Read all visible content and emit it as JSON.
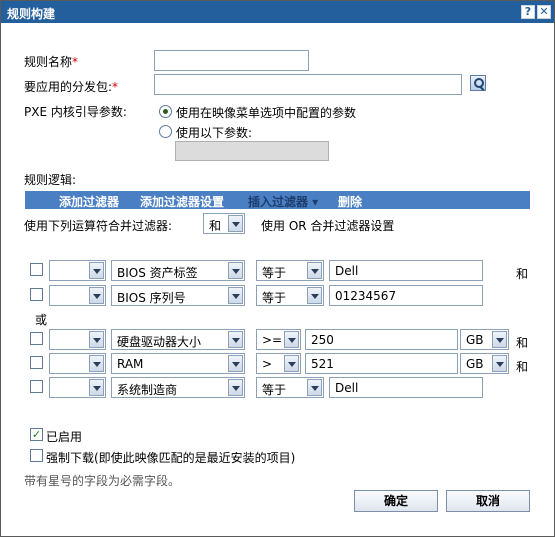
{
  "dialog": {
    "title": "规则构建",
    "help_label": "?",
    "close_label": "✕"
  },
  "form": {
    "rule_name_label": "规则名称",
    "rule_name_value": "",
    "bundle_label": "要应用的分发包:",
    "bundle_value": "",
    "required_mark": "*",
    "pxe_label": "PXE 内核引导参数:",
    "pxe_option_menu": "使用在映像菜单选项中配置的参数",
    "pxe_option_custom": "使用以下参数:",
    "pxe_custom_value": ""
  },
  "logic": {
    "section_label": "规则逻辑:",
    "toolbar": {
      "add_filter": "添加过滤器",
      "add_filter_set": "添加过滤器设置",
      "insert_filter": "插入过滤器 ▾",
      "delete": "删除"
    },
    "combine_label": "使用下列运算符合并过滤器:",
    "combine_operator": "和",
    "combine_sets_label": "使用 OR 合并过滤器设置",
    "or_label": "或",
    "filters": [
      {
        "checked": false,
        "prefix": "",
        "field": "BIOS 资产标签",
        "op": "等于",
        "value": "Dell",
        "unit": "",
        "connector": "和"
      },
      {
        "checked": false,
        "prefix": "",
        "field": "BIOS 序列号",
        "op": "等于",
        "value": "01234567",
        "unit": "",
        "connector": ""
      },
      {
        "checked": false,
        "prefix": "",
        "field": "硬盘驱动器大小",
        "op": ">=",
        "value": "250",
        "unit": "GB",
        "connector": "和"
      },
      {
        "checked": false,
        "prefix": "",
        "field": "RAM",
        "op": ">",
        "value": "521",
        "unit": "GB",
        "connector": "和"
      },
      {
        "checked": false,
        "prefix": "",
        "field": "系统制造商",
        "op": "等于",
        "value": "Dell",
        "unit": "",
        "connector": ""
      }
    ]
  },
  "options": {
    "enabled_label": "已启用",
    "enabled_checked": true,
    "force_download_label": "强制下载(即使此映像匹配的是最近安装的项目)",
    "force_download_checked": false,
    "required_note": "带有星号的字段为必需字段。"
  },
  "buttons": {
    "ok": "确定",
    "cancel": "取消"
  }
}
